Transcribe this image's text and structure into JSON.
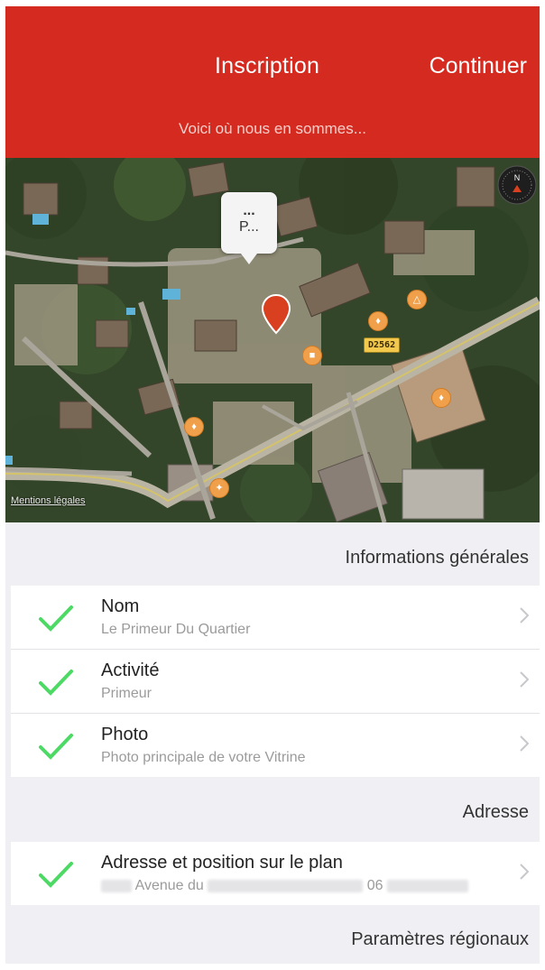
{
  "header": {
    "title": "Inscription",
    "continue_label": "Continuer",
    "subtitle": "Voici où nous en sommes..."
  },
  "map": {
    "callout_dots": "...",
    "callout_text": "P...",
    "road_label": "D2562",
    "legal_label": "Mentions légales",
    "compass_label": "N"
  },
  "sections": {
    "general_title": "Informations générales",
    "address_title": "Adresse",
    "regional_title": "Paramètres régionaux"
  },
  "general_rows": [
    {
      "label": "Nom",
      "value": "Le Primeur Du Quartier"
    },
    {
      "label": "Activité",
      "value": "Primeur"
    },
    {
      "label": "Photo",
      "value": "Photo principale de votre Vitrine"
    }
  ],
  "address_row": {
    "label": "Adresse et position sur le plan",
    "value_part1": "Avenue du",
    "value_part2": "06"
  },
  "colors": {
    "accent_red": "#d42a1f",
    "check_green": "#4cd964",
    "pin_red": "#d9401f"
  },
  "icons": {
    "check": "check-icon",
    "chevron": "chevron-right-icon",
    "pin": "map-pin-icon",
    "compass": "compass-icon"
  }
}
